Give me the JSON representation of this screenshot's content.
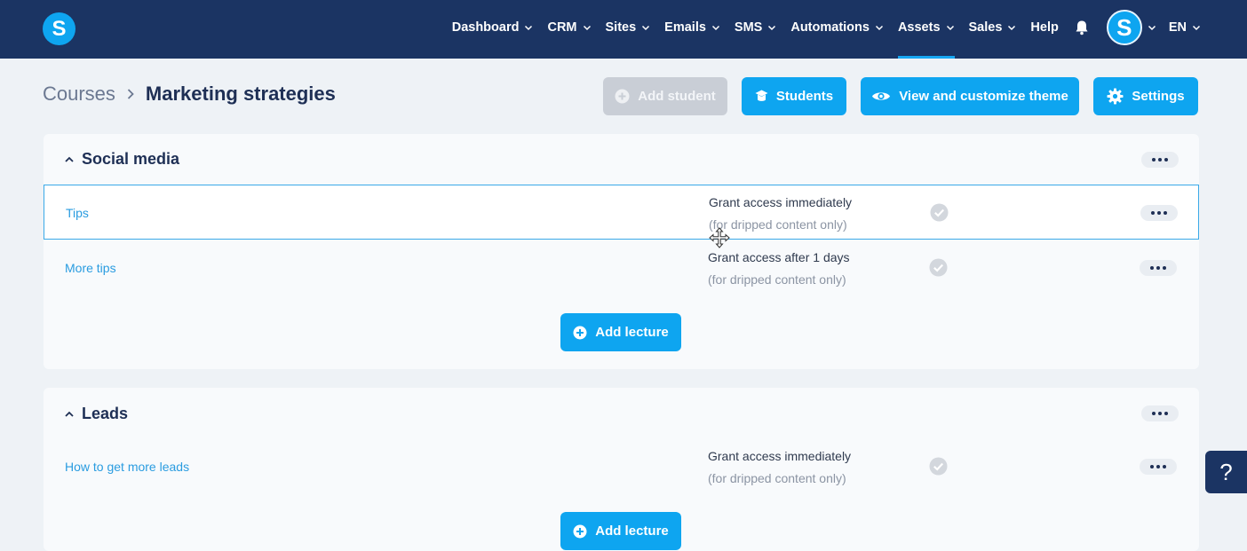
{
  "brand": {
    "logo_letter": "S",
    "accent": "#0ea5f0",
    "nav_bg": "#1b3463"
  },
  "nav": {
    "items": [
      {
        "label": "Dashboard",
        "has_menu": true
      },
      {
        "label": "CRM",
        "has_menu": true
      },
      {
        "label": "Sites",
        "has_menu": true
      },
      {
        "label": "Emails",
        "has_menu": true
      },
      {
        "label": "SMS",
        "has_menu": true
      },
      {
        "label": "Automations",
        "has_menu": true
      },
      {
        "label": "Assets",
        "has_menu": true,
        "active": true
      },
      {
        "label": "Sales",
        "has_menu": true
      },
      {
        "label": "Help",
        "has_menu": false
      }
    ],
    "avatar_letter": "S",
    "language": "EN"
  },
  "breadcrumb": {
    "root": "Courses",
    "current": "Marketing strategies"
  },
  "toolbar": {
    "add_student": "Add student",
    "students": "Students",
    "view_theme": "View and customize theme",
    "settings": "Settings"
  },
  "sections": [
    {
      "title": "Social media",
      "lectures": [
        {
          "title": "Tips",
          "access": "Grant access immediately",
          "note": "(for dripped content only)",
          "selected": true
        },
        {
          "title": "More tips",
          "access": "Grant access after 1 days",
          "note": "(for dripped content only)"
        }
      ],
      "add_label": "Add lecture"
    },
    {
      "title": "Leads",
      "lectures": [
        {
          "title": "How to get more leads",
          "access": "Grant access immediately",
          "note": "(for dripped content only)"
        }
      ],
      "add_label": "Add lecture"
    }
  ],
  "help": {
    "label": "?"
  }
}
